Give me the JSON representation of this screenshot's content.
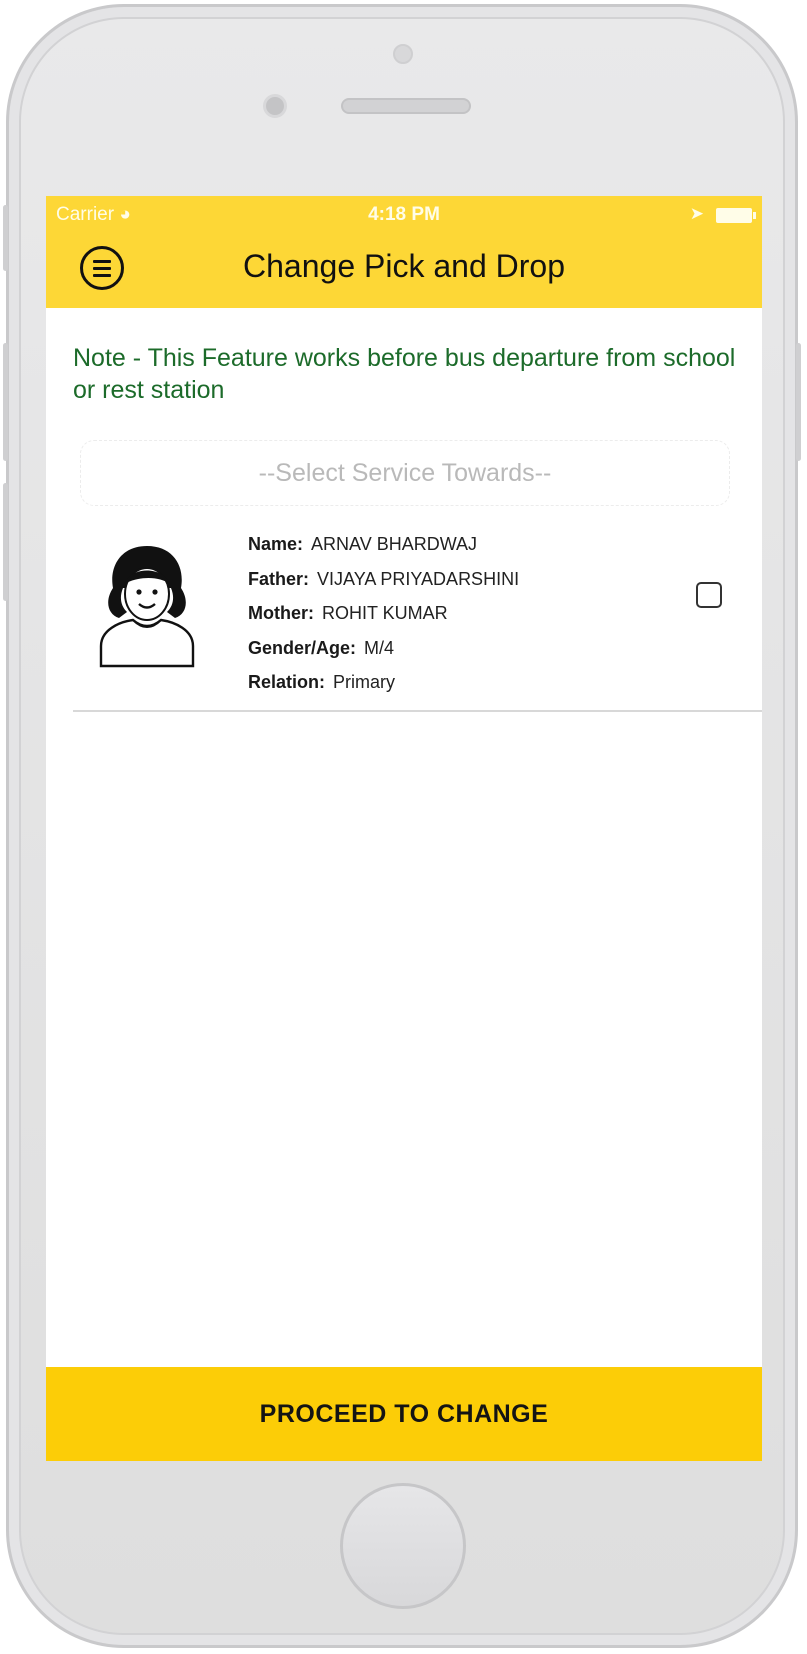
{
  "status_bar": {
    "carrier": "Carrier",
    "time": "4:18 PM"
  },
  "header": {
    "title": "Change Pick and Drop",
    "menu_icon": "menu-icon"
  },
  "note": "Note - This Feature works before bus departure from school or rest station",
  "service_select": {
    "placeholder": "--Select Service Towards--"
  },
  "student": {
    "name_label": "Name:",
    "name": "ARNAV BHARDWAJ",
    "father_label": "Father:",
    "father": "VIJAYA PRIYADARSHINI",
    "mother_label": "Mother:",
    "mother": "ROHIT KUMAR",
    "gender_age_label": "Gender/Age:",
    "gender_age": "M/4",
    "relation_label": "Relation:",
    "relation": "Primary",
    "selected": false
  },
  "footer": {
    "proceed_label": "PROCEED TO CHANGE"
  },
  "colors": {
    "nav_bg": "#fdd736",
    "button_bg": "#fccd07",
    "note_text": "#1c6b2a"
  }
}
